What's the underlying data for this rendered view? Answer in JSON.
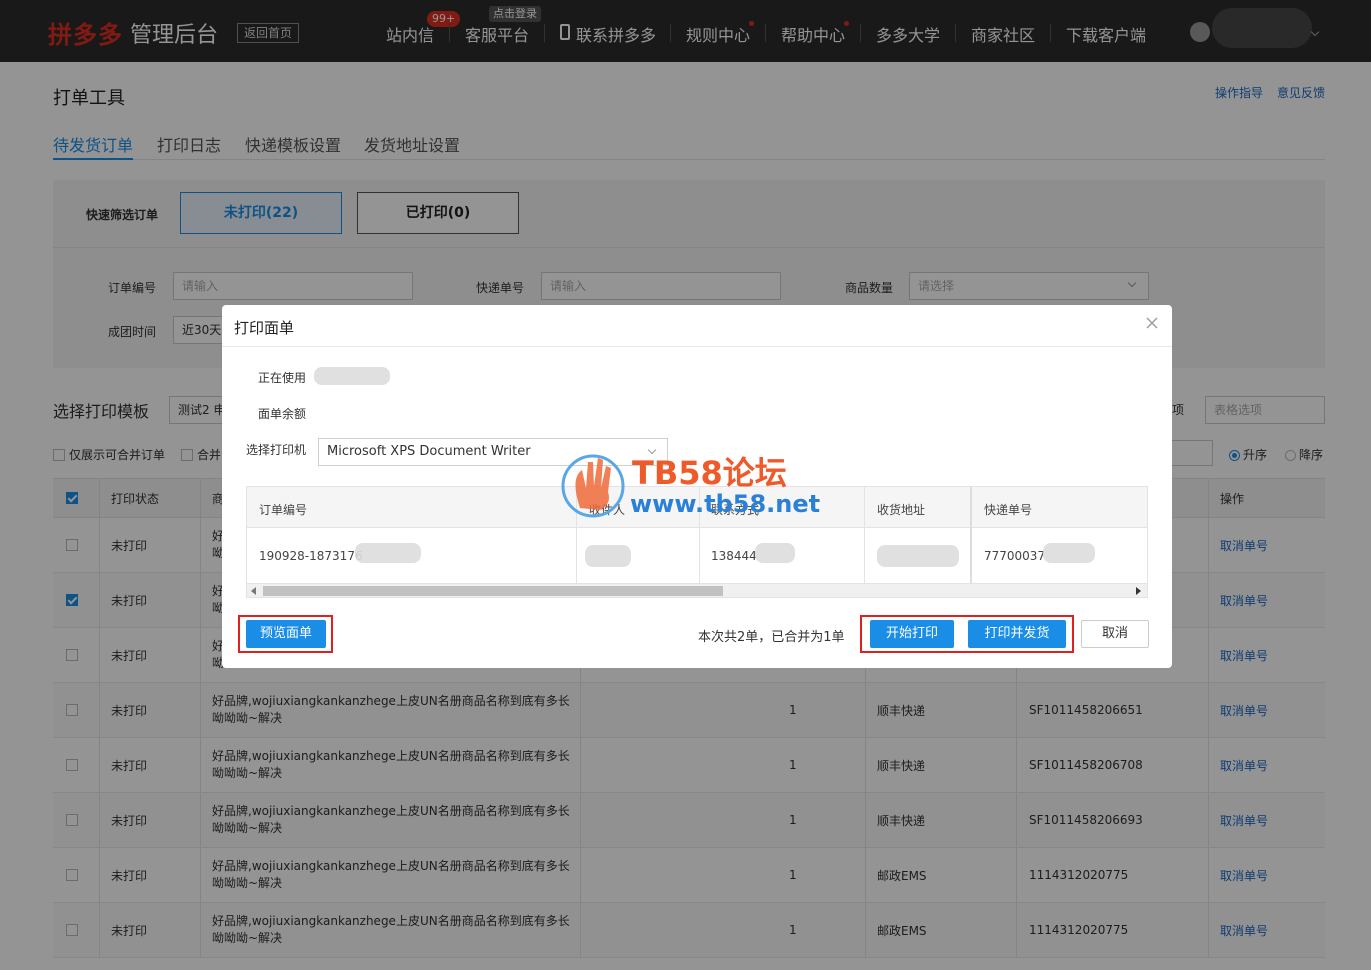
{
  "topnav": {
    "logo": "拼多多",
    "logo_sub": "管理后台",
    "home_btn": "返回首页",
    "items": [
      "站内信",
      "客服平台",
      "联系拼多多",
      "规则中心",
      "帮助中心",
      "多多大学",
      "商家社区",
      "下载客户端"
    ],
    "badge": "99+",
    "login_tag": "点击登录"
  },
  "page": {
    "title": "打单工具",
    "links": [
      "操作指导",
      "意见反馈"
    ],
    "tabs": [
      "待发货订单",
      "打印日志",
      "快递模板设置",
      "发货地址设置"
    ]
  },
  "filter": {
    "quick_label": "快速筛选订单",
    "unprinted": "未打印(22)",
    "printed": "已打印(0)",
    "order_no_label": "订单编号",
    "order_no_placeholder": "请输入",
    "express_no_label": "快递单号",
    "express_no_placeholder": "请输入",
    "qty_label": "商品数量",
    "qty_placeholder": "请选择",
    "time_label": "成团时间",
    "time_value": "近30天"
  },
  "template": {
    "label": "选择打印模板",
    "value": "测试2 申",
    "opt_label": "项",
    "table_opt_placeholder": "表格选项",
    "only_merge": "仅展示可合并订单",
    "merge": "合并",
    "asc": "升序",
    "desc": "降序"
  },
  "orders": {
    "headers": [
      "打印状态",
      "商",
      "操作"
    ],
    "rows": [
      {
        "status": "未打印",
        "checked": false,
        "product": "好",
        "product2": "呦",
        "qty": "",
        "express": "",
        "tracking": "",
        "action": "取消单号",
        "dim": true
      },
      {
        "status": "未打印",
        "checked": true,
        "product": "好",
        "product2": "呦",
        "qty": "",
        "express": "",
        "tracking": "",
        "action": "取消单号",
        "dim": false
      },
      {
        "status": "未打印",
        "checked": false,
        "product": "好",
        "product2": "呦",
        "qty": "",
        "express": "",
        "tracking": "",
        "action": "取消单号",
        "dim": false
      },
      {
        "status": "未打印",
        "checked": false,
        "product": "好品牌,wojiuxiangkankanzhege上皮UN名册商品名称到底有多长",
        "product2": "呦呦呦~解决",
        "qty": "1",
        "express": "顺丰快递",
        "tracking": "SF1011458206651",
        "action": "取消单号",
        "dim": false
      },
      {
        "status": "未打印",
        "checked": false,
        "product": "好品牌,wojiuxiangkankanzhege上皮UN名册商品名称到底有多长",
        "product2": "呦呦呦~解决",
        "qty": "1",
        "express": "顺丰快递",
        "tracking": "SF1011458206708",
        "action": "取消单号",
        "dim": false
      },
      {
        "status": "未打印",
        "checked": false,
        "product": "好品牌,wojiuxiangkankanzhege上皮UN名册商品名称到底有多长",
        "product2": "呦呦呦~解决",
        "qty": "1",
        "express": "顺丰快递",
        "tracking": "SF1011458206693",
        "action": "取消单号",
        "dim": false
      },
      {
        "status": "未打印",
        "checked": false,
        "product": "好品牌,wojiuxiangkankanzhege上皮UN名册商品名称到底有多长",
        "product2": "呦呦呦~解决",
        "qty": "1",
        "express": "邮政EMS",
        "tracking": "1114312020775",
        "action": "取消单号",
        "dim": false
      },
      {
        "status": "未打印",
        "checked": false,
        "product": "好品牌,wojiuxiangkankanzhege上皮UN名册商品名称到底有多长",
        "product2": "呦呦呦~解决",
        "qty": "1",
        "express": "邮政EMS",
        "tracking": "1114312020775",
        "action": "取消单号",
        "dim": false
      }
    ]
  },
  "modal": {
    "title": "打印面单",
    "in_use_label": "正在使用",
    "balance_label": "面单余额",
    "printer_label": "选择打印机",
    "printer_value": "Microsoft XPS Document Writer",
    "table_headers": [
      "订单编号",
      "收件人",
      "联系方式",
      "收货地址",
      "快递单号"
    ],
    "table_row": [
      "190928-1873176",
      "",
      "138444",
      "",
      "77700037"
    ],
    "preview_btn": "预览面单",
    "summary": "本次共2单，已合并为1单",
    "start_print_btn": "开始打印",
    "print_ship_btn": "打印并发货",
    "cancel_btn": "取消"
  },
  "watermark": {
    "title": "TB58论坛",
    "url": "www.tb58.net"
  }
}
